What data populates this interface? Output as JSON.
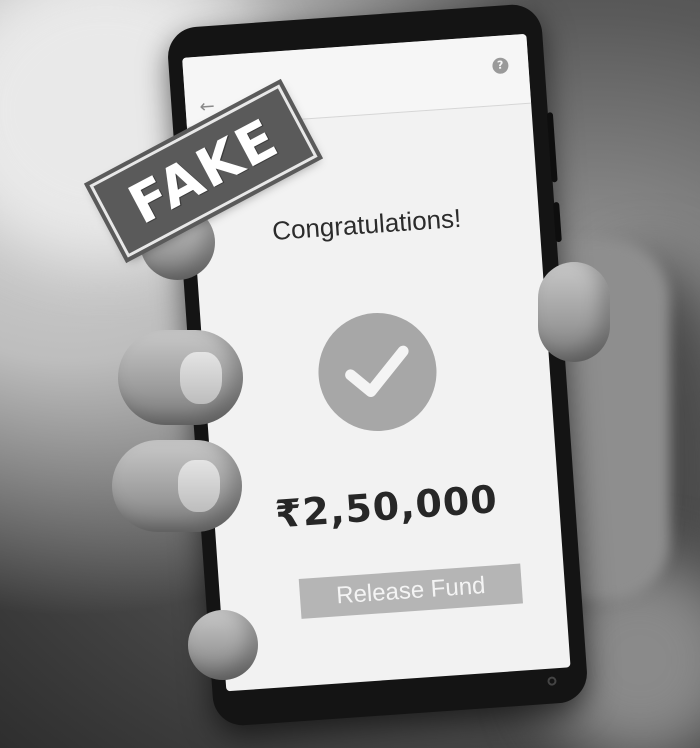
{
  "stamp": {
    "text": "FAKE"
  },
  "phone_screen": {
    "back_icon": "←",
    "help_icon": "?",
    "title": "Congratulations!",
    "status_icon": "check-circle-icon",
    "amount": "₹2,50,000",
    "release_button_label": "Release Fund"
  },
  "colors": {
    "stamp_background": "#5a5a5a",
    "screen_background": "#f2f2f2",
    "check_circle": "#a7a7a7",
    "button_background": "#b5b5b5"
  }
}
